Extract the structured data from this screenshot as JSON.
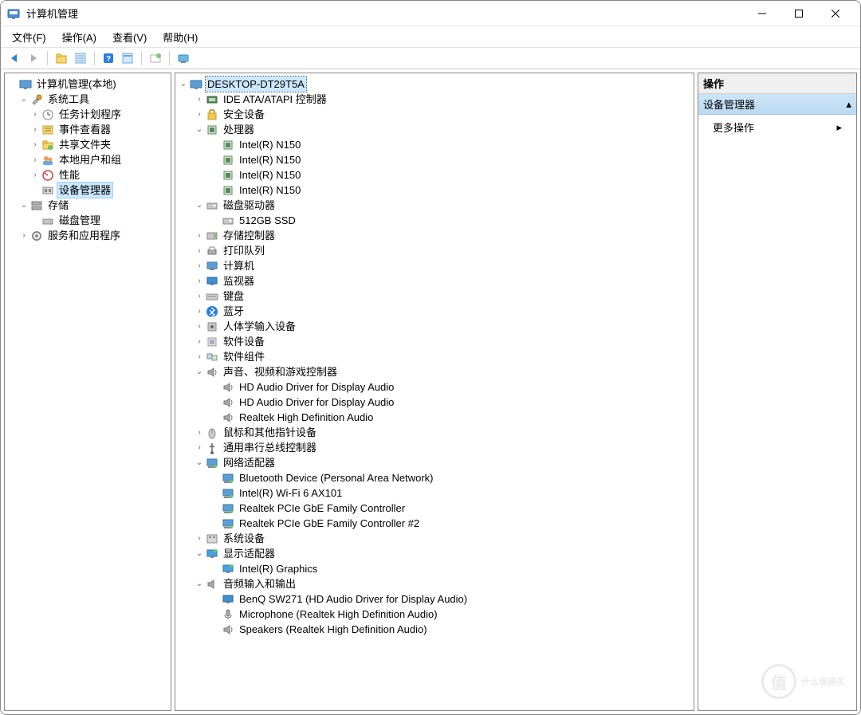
{
  "window": {
    "title": "计算机管理"
  },
  "menu": {
    "file": "文件(F)",
    "action": "操作(A)",
    "view": "查看(V)",
    "help": "帮助(H)"
  },
  "left": {
    "root": "计算机管理(本地)",
    "sys_tools": "系统工具",
    "task_scheduler": "任务计划程序",
    "event_viewer": "事件查看器",
    "shared_folders": "共享文件夹",
    "local_users": "本地用户和组",
    "performance": "性能",
    "device_manager": "设备管理器",
    "storage": "存储",
    "disk_mgmt": "磁盘管理",
    "services_apps": "服务和应用程序"
  },
  "mid": {
    "root": "DESKTOP-DT29T5A",
    "ide": "IDE ATA/ATAPI 控制器",
    "security": "安全设备",
    "processors": "处理器",
    "cpu": [
      "Intel(R) N150",
      "Intel(R) N150",
      "Intel(R) N150",
      "Intel(R) N150"
    ],
    "disk_drives": "磁盘驱动器",
    "ssd": "512GB SSD",
    "storage_ctrl": "存储控制器",
    "print_queues": "打印队列",
    "computer": "计算机",
    "monitors": "监视器",
    "keyboards": "键盘",
    "bluetooth": "蓝牙",
    "hid": "人体学输入设备",
    "soft_dev": "软件设备",
    "soft_comp": "软件组件",
    "sound": "声音、视频和游戏控制器",
    "sound_items": [
      "HD Audio Driver for Display Audio",
      "HD Audio Driver for Display Audio",
      "Realtek High Definition Audio"
    ],
    "mice": "鼠标和其他指针设备",
    "usb": "通用串行总线控制器",
    "network": "网络适配器",
    "network_items": [
      "Bluetooth Device (Personal Area Network)",
      "Intel(R) Wi-Fi 6 AX101",
      "Realtek PCIe GbE Family Controller",
      "Realtek PCIe GbE Family Controller #2"
    ],
    "system_dev": "系统设备",
    "display": "显示适配器",
    "display_items": [
      "Intel(R) Graphics"
    ],
    "audio_io": "音频输入和输出",
    "audio_items": [
      "BenQ SW271 (HD Audio Driver for Display Audio)",
      "Microphone (Realtek High Definition Audio)",
      "Speakers (Realtek High Definition Audio)"
    ]
  },
  "right": {
    "header": "操作",
    "group": "设备管理器",
    "more": "更多操作"
  },
  "watermark": "什么值得买"
}
